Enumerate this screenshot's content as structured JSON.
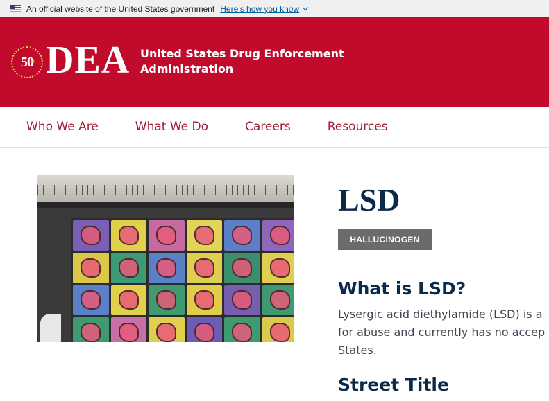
{
  "gov_banner": {
    "text": "An official website of the United States government",
    "link": "Here’s how you know"
  },
  "header": {
    "seal_text": "50",
    "seal_sub": "th",
    "logo": "DEA",
    "agency_line1": "United States Drug Enforcement",
    "agency_line2": "Administration"
  },
  "nav": {
    "items": [
      {
        "label": "Who We Are"
      },
      {
        "label": "What We Do"
      },
      {
        "label": "Careers"
      },
      {
        "label": "Resources"
      }
    ]
  },
  "content": {
    "title": "LSD",
    "badge": "HALLUCINOGEN",
    "what_heading": "What is LSD?",
    "what_lines": [
      "Lysergic acid diethylamide (LSD) is a",
      "for abuse and currently has no accep",
      "States."
    ],
    "street_heading": "Street Title"
  },
  "colors": {
    "brand_red": "#c20b2c",
    "navy": "#0b2a4a",
    "badge_gray": "#6b6b6b",
    "link_blue": "#005ea2"
  },
  "icons": [
    "us-flag-icon",
    "chevron-down-icon",
    "dea-50th-seal-icon"
  ]
}
